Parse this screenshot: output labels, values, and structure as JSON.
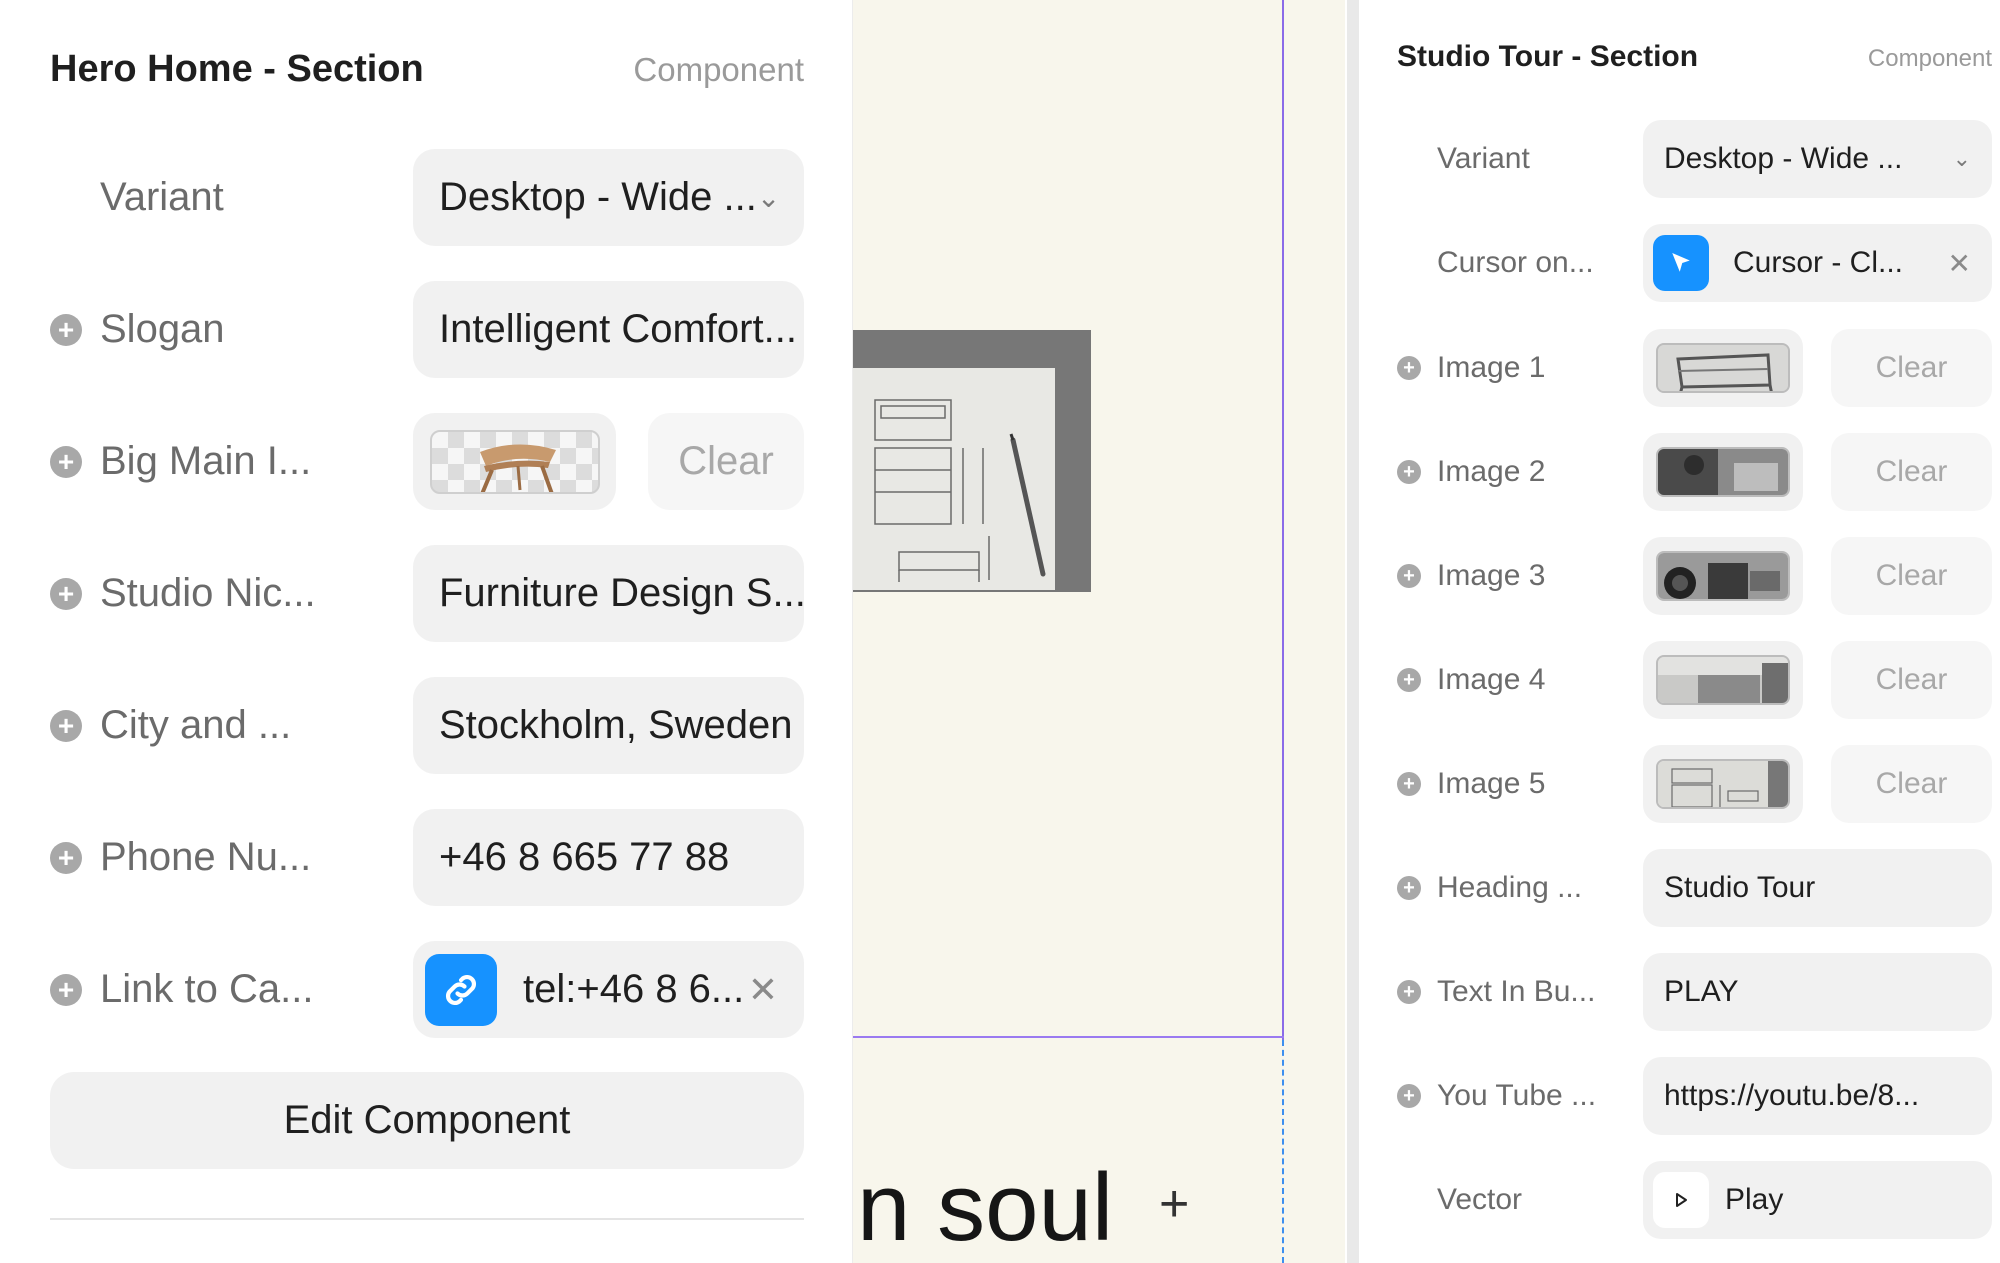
{
  "left_panel": {
    "title": "Hero Home - Section",
    "tag": "Component",
    "variant": {
      "label": "Variant",
      "value": "Desktop - Wide ..."
    },
    "slogan": {
      "label": "Slogan",
      "value": "Intelligent Comfort..."
    },
    "big_main_image": {
      "label": "Big Main I...",
      "clear": "Clear"
    },
    "studio_nickname": {
      "label": "Studio Nic...",
      "value": "Furniture Design S..."
    },
    "city": {
      "label": "City and ...",
      "value": "Stockholm, Sweden"
    },
    "phone": {
      "label": "Phone Nu...",
      "value": "+46 8 665 77 88"
    },
    "link_to_call": {
      "label": "Link to Ca...",
      "value": "tel:+46 8 6..."
    },
    "edit_component": "Edit Component"
  },
  "canvas": {
    "text_fragment": "n soul",
    "plus": "+"
  },
  "right_panel": {
    "title": "Studio Tour - Section",
    "tag": "Component",
    "variant": {
      "label": "Variant",
      "value": "Desktop - Wide ..."
    },
    "cursor": {
      "label": "Cursor on...",
      "value": "Cursor - Cl..."
    },
    "images": [
      {
        "label": "Image 1",
        "clear": "Clear"
      },
      {
        "label": "Image 2",
        "clear": "Clear"
      },
      {
        "label": "Image 3",
        "clear": "Clear"
      },
      {
        "label": "Image 4",
        "clear": "Clear"
      },
      {
        "label": "Image 5",
        "clear": "Clear"
      }
    ],
    "heading": {
      "label": "Heading ...",
      "value": "Studio Tour"
    },
    "text_in_button": {
      "label": "Text In Bu...",
      "value": "PLAY"
    },
    "youtube": {
      "label": "You Tube ...",
      "value": "https://youtu.be/8..."
    },
    "vector": {
      "label": "Vector",
      "value": "Play"
    }
  },
  "colors": {
    "accent": "#1692ff",
    "frame": "#8b6be8",
    "canvas_bg": "#f8f6ec"
  }
}
